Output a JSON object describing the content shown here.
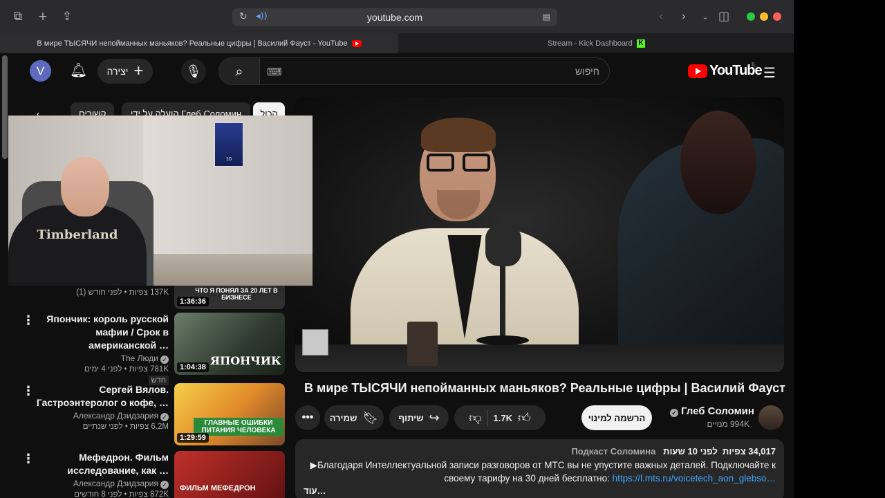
{
  "browser": {
    "url": "youtube.com",
    "tabs": [
      {
        "title": "В мире ТЫСЯЧИ непойманных маньяков? Реальные цифры | Василий Фауст - YouTube",
        "active": true
      },
      {
        "title": "Stream - Kick Dashboard",
        "active": false
      }
    ],
    "kick_favicon_letter": "K"
  },
  "header": {
    "avatar_letter": "V",
    "create_label": "יצירה",
    "search_placeholder": "חיפוש",
    "logo_text": "YouTube",
    "country_code": "IL"
  },
  "chips": [
    {
      "label": "הכול",
      "selected": true
    },
    {
      "label": "הועלה על ידי Глеб Соломин",
      "selected": false
    },
    {
      "label": "קשורים",
      "selected": false
    }
  ],
  "webcam": {
    "shirt_brand": "Timberland",
    "poster_text": "10"
  },
  "recommendations": [
    {
      "title": "",
      "channel": "",
      "stats": "137K צפיות • לפני חודש (1)",
      "duration": "1:36:36",
      "thumb_caption": "ЧТО Я ПОНЯЛ ЗА 20 ЛЕТ В БИЗНЕСЕ",
      "is_new": false
    },
    {
      "title": "Япончик: король русской мафии / Срок в американской …",
      "channel": "The Люди",
      "stats": "781K צפיות • לפני 4 ימים",
      "duration": "1:04:38",
      "thumb_caption": "ЯПОНЧИК",
      "is_new": true,
      "new_label": "חדש"
    },
    {
      "title": "Сергей Вялов. Гастроэнтеролог о кофе, …",
      "channel": "Александр Дзидзария",
      "stats": "6.2M צפיות • לפני שנתיים",
      "duration": "1:29:59",
      "thumb_caption": "ГЛАВНЫЕ ОШИБКИ ПИТАНИЯ ЧЕЛОВЕКА",
      "is_new": false
    },
    {
      "title": "Мефедрон. Фильм исследование, как …",
      "channel": "Александр Дзидзария",
      "stats": "872K צפיות • לפני 8 חודשים",
      "duration": "",
      "thumb_caption": "ФИЛЬМ МЕФЕДРОН",
      "is_new": false
    }
  ],
  "video": {
    "title": "В мире ТЫСЯЧИ непойманных маньяков? Реальные цифры | Василий Фауст",
    "channel_name": "Глеб Соломин",
    "subscribers": "994K מנויים",
    "subscribe_label": "הרשמה למינוי",
    "like_count": "1.7K",
    "share_label": "שיתוף",
    "save_label": "שמירה"
  },
  "description": {
    "views": "34,017 צפיות",
    "time": "לפני 10 שעות",
    "tags": "Подкаст Соломина",
    "text": "▶Благодаря Интеллектуальной записи разговоров от МТС вы не упустите важных деталей. Подключайте к своему тарифу на 30 дней бесплатно:",
    "link": "https://l.mts.ru/voicetech_aon_glebso…",
    "more_label": "…עוד"
  },
  "colors": {
    "accent_red": "#ff0000",
    "link_blue": "#3ea6ff",
    "kick_green": "#53fc18",
    "avatar_purple": "#5c6bc0"
  }
}
